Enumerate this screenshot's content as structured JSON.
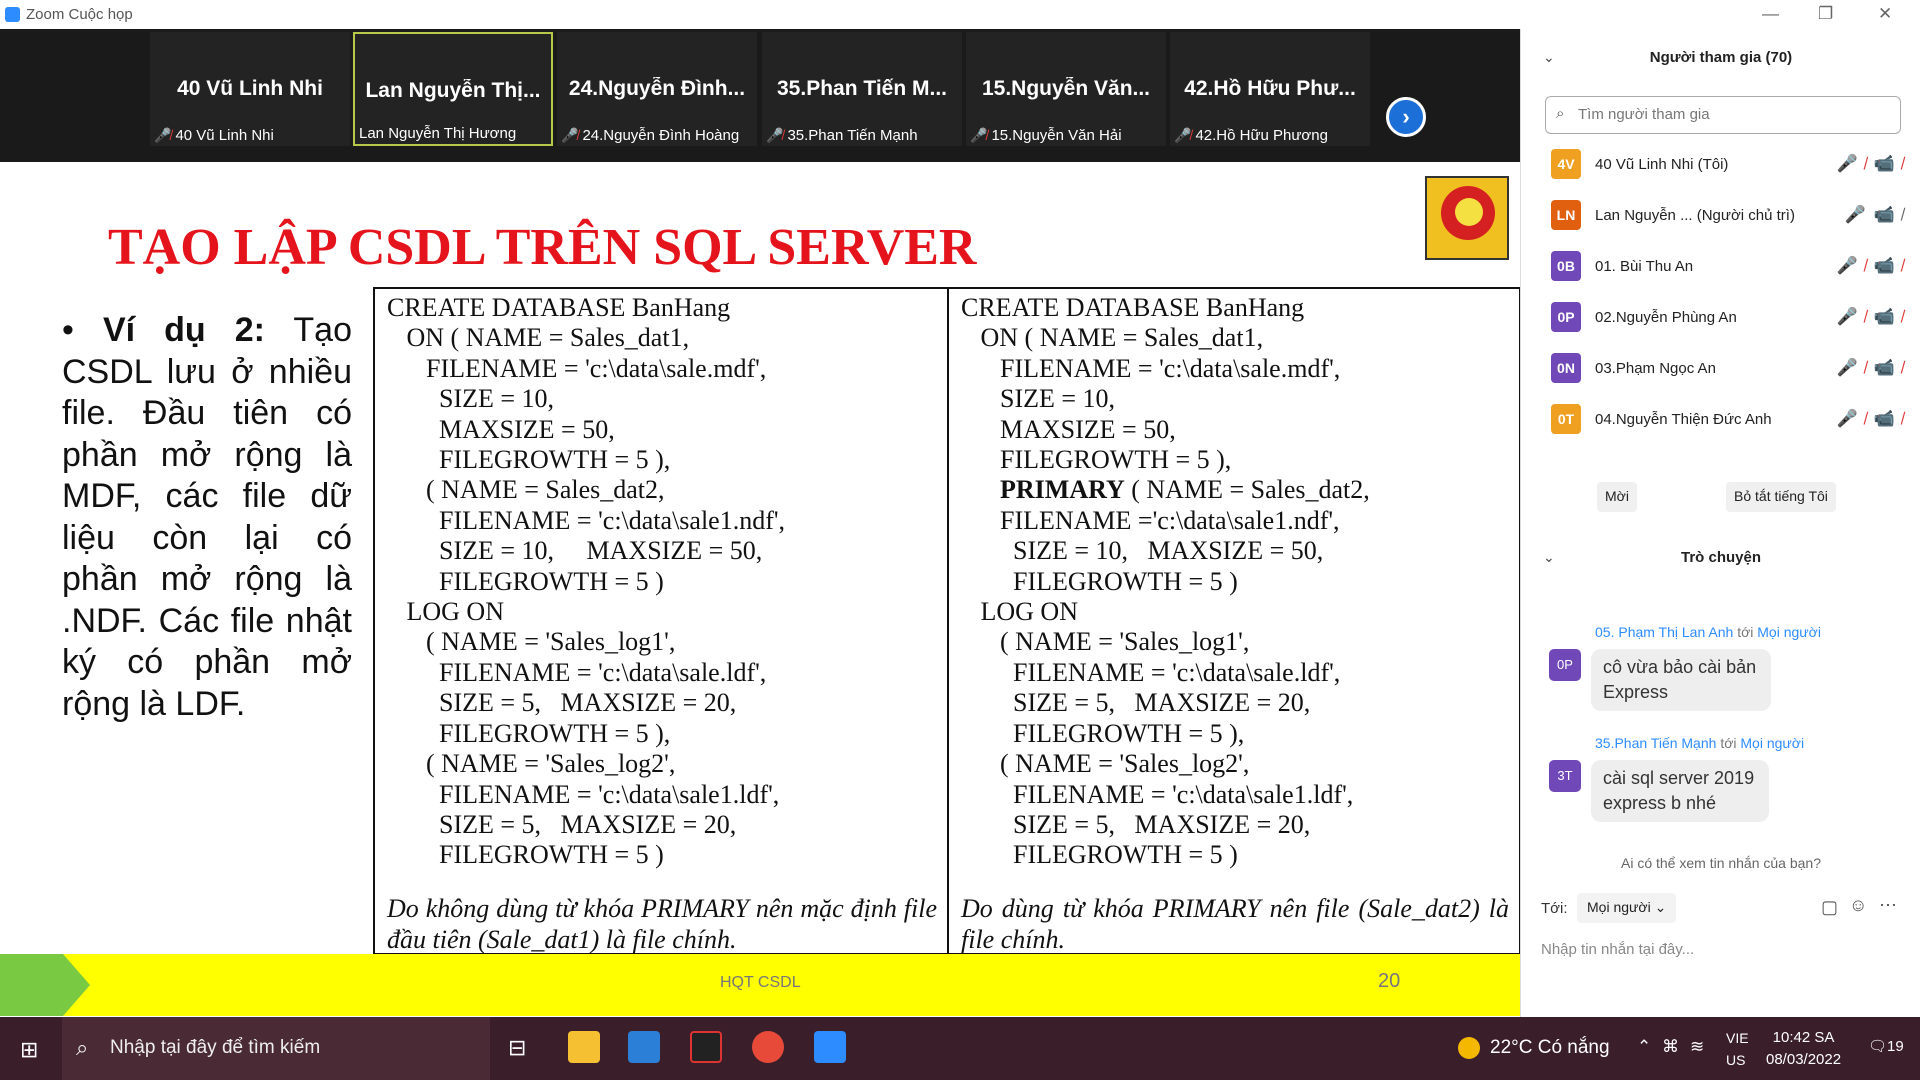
{
  "window": {
    "title": "Zoom Cuộc họp"
  },
  "gallery": {
    "tiles": [
      {
        "display": "40 Vũ Linh Nhi",
        "label": "40 Vũ Linh Nhi"
      },
      {
        "display": "Lan Nguyễn Thị...",
        "label": "Lan Nguyễn Thị Hương"
      },
      {
        "display": "24.Nguyễn Đình...",
        "label": "24.Nguyễn Đình Hoàng"
      },
      {
        "display": "35.Phan Tiến M...",
        "label": "35.Phan Tiến Mạnh"
      },
      {
        "display": "15.Nguyễn Văn...",
        "label": "15.Nguyễn Văn Hải"
      },
      {
        "display": "42.Hồ Hữu Phư...",
        "label": "42.Hồ Hữu Phương"
      }
    ],
    "next_icon": "chevron-right-icon"
  },
  "slide": {
    "title": "TẠO LẬP CSDL TRÊN SQL SERVER",
    "bullet_bold": "Ví dụ 2:",
    "bullet_text": "Tạo CSDL lưu ở nhiều file. Đầu tiên có phần mở rộng là MDF, các file dữ liệu còn lại có phần mở rộng là .NDF. Các file nhật ký có phần mở rộng là LDF.",
    "code_left": "CREATE DATABASE BanHang\n   ON ( NAME = Sales_dat1,\n      FILENAME = 'c:\\data\\sale.mdf',\n        SIZE = 10,\n        MAXSIZE = 50,\n        FILEGROWTH = 5 ),\n      ( NAME = Sales_dat2,\n        FILENAME = 'c:\\data\\sale1.ndf',\n        SIZE = 10,     MAXSIZE = 50,\n        FILEGROWTH = 5 )\n   LOG ON\n      ( NAME = 'Sales_log1',\n        FILENAME = 'c:\\data\\sale.ldf',\n        SIZE = 5,   MAXSIZE = 20,\n        FILEGROWTH = 5 ),\n      ( NAME = 'Sales_log2',\n        FILENAME = 'c:\\data\\sale1.ldf',\n        SIZE = 5,   MAXSIZE = 20,\n        FILEGROWTH = 5 )",
    "code_right_a": "CREATE DATABASE BanHang\n   ON ( NAME = Sales_dat1,\n      FILENAME = 'c:\\data\\sale.mdf',\n      SIZE = 10,\n      MAXSIZE = 50,\n      FILEGROWTH = 5 ),\n      ",
    "code_right_kw": "PRIMARY",
    "code_right_b": " ( NAME = Sales_dat2,\n      FILENAME ='c:\\data\\sale1.ndf',\n        SIZE = 10,   MAXSIZE = 50,\n        FILEGROWTH = 5 )\n   LOG ON\n      ( NAME = 'Sales_log1',\n        FILENAME = 'c:\\data\\sale.ldf',\n        SIZE = 5,   MAXSIZE = 20,\n        FILEGROWTH = 5 ),\n      ( NAME = 'Sales_log2',\n        FILENAME = 'c:\\data\\sale1.ldf',\n        SIZE = 5,   MAXSIZE = 20,\n        FILEGROWTH = 5 )",
    "note_left": "Do không dùng từ khóa PRIMARY nên mặc định file đầu tiên (Sale_dat1) là file chính.",
    "note_right": "Do dùng từ khóa PRIMARY nên file (Sale_dat2) là file chính.",
    "footer_text": "HQT CSDL",
    "page_number": "20"
  },
  "participants": {
    "header": "Người tham gia (70)",
    "search_placeholder": "Tìm người tham gia",
    "list": [
      {
        "initials": "4V",
        "color": "#f0a020",
        "name": "40 Vũ Linh Nhi (Tôi)"
      },
      {
        "initials": "LN",
        "color": "#e06010",
        "name": "Lan Nguyễn ...  (Người chủ trì)"
      },
      {
        "initials": "0B",
        "color": "#7048b8",
        "name": "01. Bùi Thu An"
      },
      {
        "initials": "0P",
        "color": "#7048b8",
        "name": "02.Nguyễn Phùng An"
      },
      {
        "initials": "0N",
        "color": "#7048b8",
        "name": "03.Phạm Ngọc An"
      },
      {
        "initials": "0T",
        "color": "#f0a020",
        "name": "04.Nguyễn Thiện Đức Anh"
      }
    ],
    "invite_label": "Mời",
    "mute_all_label": "Bỏ tắt tiếng Tôi"
  },
  "chat": {
    "header": "Trò chuyện",
    "messages": [
      {
        "initials": "0P",
        "sender": "05. Phạm Thị Lan Anh",
        "to_word": "tới",
        "to": "Mọi người",
        "text": "cô vừa bảo cài bản Express"
      },
      {
        "initials": "3T",
        "sender": "35.Phan Tiến Mạnh",
        "to_word": "tới",
        "to": "Mọi người",
        "text": "cài sql server 2019 express b nhé"
      }
    ],
    "who_can_see": "Ai có thể xem tin nhắn của bạn?",
    "to_label": "Tới:",
    "to_value": "Mọi người",
    "input_placeholder": "Nhập tin nhắn tại đây..."
  },
  "taskbar": {
    "search_placeholder": "Nhập tại đây để tìm kiếm",
    "weather": "22°C  Có nắng",
    "language": "VIE",
    "region": "US",
    "time": "10:42 SA",
    "date": "08/03/2022",
    "notif_count": "19"
  }
}
